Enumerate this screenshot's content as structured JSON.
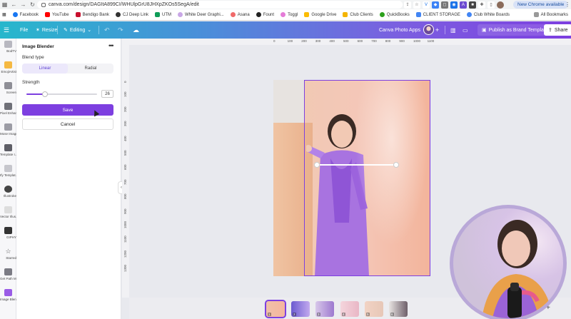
{
  "browser": {
    "url": "canva.com/design/DAGItA899CI/WHUlpGrU8JHXpZKOs5SegA/edit",
    "chrome_notice": "New Chrome available",
    "bookmarks": [
      {
        "label": "Facebook",
        "color": "#1877f2"
      },
      {
        "label": "YouTube",
        "color": "#ff0000"
      },
      {
        "label": "Bendigo Bank",
        "color": "#c8102e"
      },
      {
        "label": "CJ Deep Link",
        "color": "#333333"
      },
      {
        "label": "UTM",
        "color": "#0f9d58"
      },
      {
        "label": "White Deer Graphi...",
        "color": "#c9a7e6"
      },
      {
        "label": "Asana",
        "color": "#f06a6a"
      },
      {
        "label": "Fount",
        "color": "#222222"
      },
      {
        "label": "Toggl",
        "color": "#e57cd8"
      },
      {
        "label": "Google Drive",
        "color": "#fbbc04"
      },
      {
        "label": "Club Clients",
        "color": "#f4b400"
      },
      {
        "label": "QuickBooks",
        "color": "#2ca01c"
      },
      {
        "label": "CLIENT STORAGE",
        "color": "#4285f4"
      },
      {
        "label": "Club White Boards",
        "color": "#4285f4"
      }
    ],
    "all_bookmarks": "All Bookmarks"
  },
  "toolbar": {
    "file": "File",
    "resize": "Resize",
    "editing": "Editing",
    "app_name": "Canva Photo Apps",
    "publish": "Publish as Brand Template",
    "share": "Share"
  },
  "rail": [
    {
      "label": "BodTV"
    },
    {
      "label": "EmojiArtist"
    },
    {
      "label": "Screen"
    },
    {
      "label": "Pixel Enhan..."
    },
    {
      "label": "Mose Image"
    },
    {
      "label": "Template I..."
    },
    {
      "label": "Ify Templat..."
    },
    {
      "label": "Illustroke"
    },
    {
      "label": "Vector Illus..."
    },
    {
      "label": "GIPHY"
    },
    {
      "label": "Starred"
    },
    {
      "label": "Get Path M..."
    },
    {
      "label": "Image Blen..."
    }
  ],
  "panel": {
    "title": "Image Blender",
    "more": "•••",
    "blend_type_label": "Blend type",
    "blend_options": [
      "Linear",
      "Radial"
    ],
    "selected_blend": "Linear",
    "strength_label": "Strength",
    "strength_value": "26",
    "strength_fraction": 0.26,
    "save": "Save",
    "cancel": "Cancel"
  },
  "ruler": {
    "top": [
      "0",
      "100",
      "200",
      "300",
      "400",
      "500",
      "600",
      "700",
      "800",
      "900",
      "1000",
      "1100"
    ],
    "left": [
      "0",
      "100",
      "200",
      "300",
      "400",
      "500",
      "600",
      "700",
      "800",
      "900",
      "1000",
      "1100",
      "1200",
      "1300"
    ]
  },
  "pages": [
    "1",
    "2",
    "3",
    "4",
    "5",
    "6"
  ],
  "colors": {
    "accent": "#7d3fe0",
    "toolbar_start": "#27b7cc",
    "toolbar_end": "#7d3fe0"
  }
}
